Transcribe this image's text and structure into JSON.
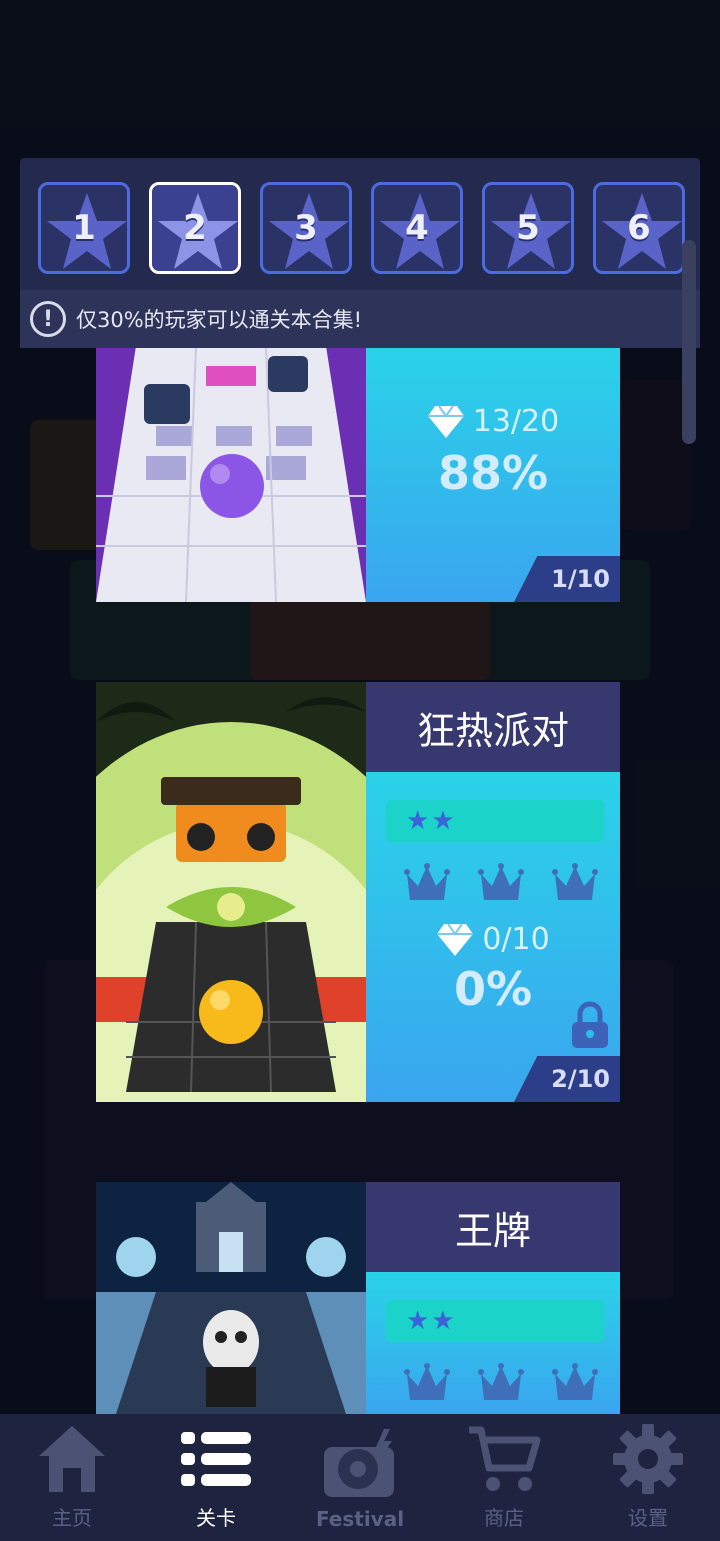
{
  "set_selector": {
    "sets": [
      {
        "label": "1",
        "active": false
      },
      {
        "label": "2",
        "active": true
      },
      {
        "label": "3",
        "active": false
      },
      {
        "label": "4",
        "active": false
      },
      {
        "label": "5",
        "active": false
      },
      {
        "label": "6",
        "active": false
      }
    ],
    "notice_icon": "exclamation-icon",
    "notice_text": "仅30%的玩家可以通关本合集!"
  },
  "levels": [
    {
      "gems": "13/20",
      "progress": "88%",
      "page": "1/10"
    },
    {
      "title": "狂热派对",
      "stars": "★★",
      "crowns": 3,
      "gems": "0/10",
      "progress": "0%",
      "locked": true,
      "page": "2/10"
    },
    {
      "title": "王牌",
      "stars": "★★",
      "crowns": 3
    }
  ],
  "bottom_nav": [
    {
      "label": "主页",
      "icon": "home-icon",
      "active": false
    },
    {
      "label": "关卡",
      "icon": "list-icon",
      "active": true
    },
    {
      "label": "Festival",
      "icon": "disc-icon",
      "active": false
    },
    {
      "label": "商店",
      "icon": "cart-icon",
      "active": false
    },
    {
      "label": "设置",
      "icon": "gear-icon",
      "active": false
    }
  ],
  "colors": {
    "panel": "#242a4d",
    "card_head": "#36386f",
    "card_body_top": "#2ad3e8",
    "card_body_bottom": "#3aa5ef",
    "nav_bg": "#1e2440"
  }
}
